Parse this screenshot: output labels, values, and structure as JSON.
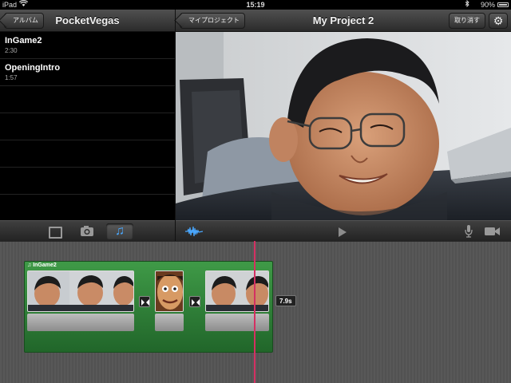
{
  "status_bar": {
    "carrier": "iPad",
    "time": "15:19",
    "battery": "90%"
  },
  "left_panel": {
    "back_button": "アルバム",
    "title": "PocketVegas",
    "items": [
      {
        "name": "InGame2",
        "duration": "2:30"
      },
      {
        "name": "OpeningIntro",
        "duration": "1:57"
      }
    ]
  },
  "right_panel": {
    "back_button": "マイプロジェクト",
    "title": "My Project 2",
    "undo_button": "取り消す"
  },
  "toolbar": {
    "media_tabs": [
      "video-tab",
      "photo-tab",
      "music-tab"
    ],
    "selected_tab": "music-tab"
  },
  "timeline": {
    "music_track_label": "InGame2",
    "playhead_time": "7.9s"
  },
  "colors": {
    "accent_blue": "#4aa8ff",
    "music_track_green": "#2f8a38",
    "playhead_pink": "#d43062"
  }
}
